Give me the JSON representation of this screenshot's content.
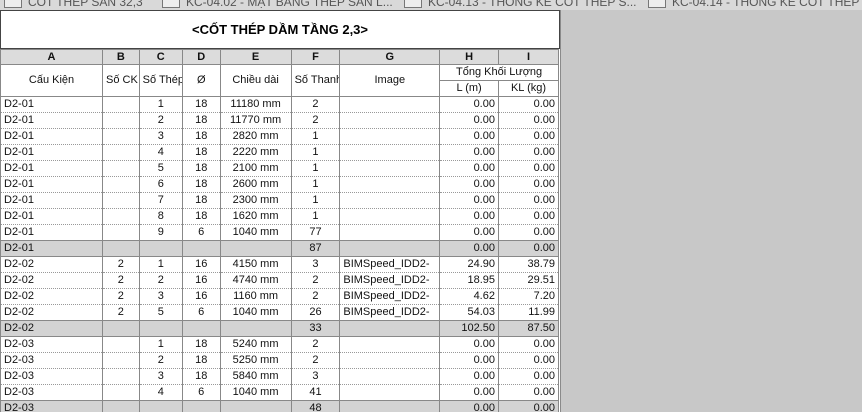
{
  "tabs": [
    {
      "label": "CỐT THÉP SÀN 32,3"
    },
    {
      "label": "KC-04.02 - MẶT BẰNG THÉP SÀN L..."
    },
    {
      "label": "KC-04.13 - THỐNG KÊ CỐT THÉP S..."
    },
    {
      "label": "KC-04.14 - THỐNG KÊ CỐT THÉP D..."
    }
  ],
  "schedule": {
    "title": "<CỐT THÉP DẦM TẦNG 2,3>",
    "column_letters": [
      "A",
      "B",
      "C",
      "D",
      "E",
      "F",
      "G",
      "H",
      "I"
    ],
    "headers": {
      "cau_kien": "Cấu Kiện",
      "so_ck": "Số CK",
      "so_thep": "Số Thép",
      "phi": "Ø",
      "chieu_dai": "Chiều dài",
      "so_thanh": "Số Thanh",
      "image": "Image",
      "tong_khoi_luong": "Tổng Khối Lượng",
      "l_m": "L (m)",
      "kl_kg": "KL (kg)"
    },
    "rows": [
      {
        "type": "data",
        "a": "D2-01",
        "b": "",
        "c": "1",
        "d": "18",
        "e": "11180 mm",
        "f": "2",
        "g": "",
        "h": "0.00",
        "i": "0.00"
      },
      {
        "type": "data",
        "a": "D2-01",
        "b": "",
        "c": "2",
        "d": "18",
        "e": "11770 mm",
        "f": "2",
        "g": "",
        "h": "0.00",
        "i": "0.00"
      },
      {
        "type": "data",
        "a": "D2-01",
        "b": "",
        "c": "3",
        "d": "18",
        "e": "2820 mm",
        "f": "1",
        "g": "",
        "h": "0.00",
        "i": "0.00"
      },
      {
        "type": "data",
        "a": "D2-01",
        "b": "",
        "c": "4",
        "d": "18",
        "e": "2220 mm",
        "f": "1",
        "g": "",
        "h": "0.00",
        "i": "0.00"
      },
      {
        "type": "data",
        "a": "D2-01",
        "b": "",
        "c": "5",
        "d": "18",
        "e": "2100 mm",
        "f": "1",
        "g": "",
        "h": "0.00",
        "i": "0.00"
      },
      {
        "type": "data",
        "a": "D2-01",
        "b": "",
        "c": "6",
        "d": "18",
        "e": "2600 mm",
        "f": "1",
        "g": "",
        "h": "0.00",
        "i": "0.00"
      },
      {
        "type": "data",
        "a": "D2-01",
        "b": "",
        "c": "7",
        "d": "18",
        "e": "2300 mm",
        "f": "1",
        "g": "",
        "h": "0.00",
        "i": "0.00"
      },
      {
        "type": "data",
        "a": "D2-01",
        "b": "",
        "c": "8",
        "d": "18",
        "e": "1620 mm",
        "f": "1",
        "g": "",
        "h": "0.00",
        "i": "0.00"
      },
      {
        "type": "data",
        "a": "D2-01",
        "b": "",
        "c": "9",
        "d": "6",
        "e": "1040 mm",
        "f": "77",
        "g": "",
        "h": "0.00",
        "i": "0.00"
      },
      {
        "type": "sum",
        "a": "D2-01",
        "b": "",
        "c": "",
        "d": "",
        "e": "",
        "f": "87",
        "g": "",
        "h": "0.00",
        "i": "0.00"
      },
      {
        "type": "data",
        "a": "D2-02",
        "b": "2",
        "c": "1",
        "d": "16",
        "e": "4150 mm",
        "f": "3",
        "g": "BIMSpeed_IDD2-",
        "h": "24.90",
        "i": "38.79"
      },
      {
        "type": "data",
        "a": "D2-02",
        "b": "2",
        "c": "2",
        "d": "16",
        "e": "4740 mm",
        "f": "2",
        "g": "BIMSpeed_IDD2-",
        "h": "18.95",
        "i": "29.51"
      },
      {
        "type": "data",
        "a": "D2-02",
        "b": "2",
        "c": "3",
        "d": "16",
        "e": "1160 mm",
        "f": "2",
        "g": "BIMSpeed_IDD2-",
        "h": "4.62",
        "i": "7.20"
      },
      {
        "type": "data",
        "a": "D2-02",
        "b": "2",
        "c": "5",
        "d": "6",
        "e": "1040 mm",
        "f": "26",
        "g": "BIMSpeed_IDD2-",
        "h": "54.03",
        "i": "11.99"
      },
      {
        "type": "sum",
        "a": "D2-02",
        "b": "",
        "c": "",
        "d": "",
        "e": "",
        "f": "33",
        "g": "",
        "h": "102.50",
        "i": "87.50"
      },
      {
        "type": "data",
        "a": "D2-03",
        "b": "",
        "c": "1",
        "d": "18",
        "e": "5240 mm",
        "f": "2",
        "g": "",
        "h": "0.00",
        "i": "0.00"
      },
      {
        "type": "data",
        "a": "D2-03",
        "b": "",
        "c": "2",
        "d": "18",
        "e": "5250 mm",
        "f": "2",
        "g": "",
        "h": "0.00",
        "i": "0.00"
      },
      {
        "type": "data",
        "a": "D2-03",
        "b": "",
        "c": "3",
        "d": "18",
        "e": "5840 mm",
        "f": "3",
        "g": "",
        "h": "0.00",
        "i": "0.00"
      },
      {
        "type": "data",
        "a": "D2-03",
        "b": "",
        "c": "4",
        "d": "6",
        "e": "1040 mm",
        "f": "41",
        "g": "",
        "h": "0.00",
        "i": "0.00"
      },
      {
        "type": "sum",
        "a": "D2-03",
        "b": "",
        "c": "",
        "d": "",
        "e": "",
        "f": "48",
        "g": "",
        "h": "0.00",
        "i": "0.00"
      }
    ]
  }
}
